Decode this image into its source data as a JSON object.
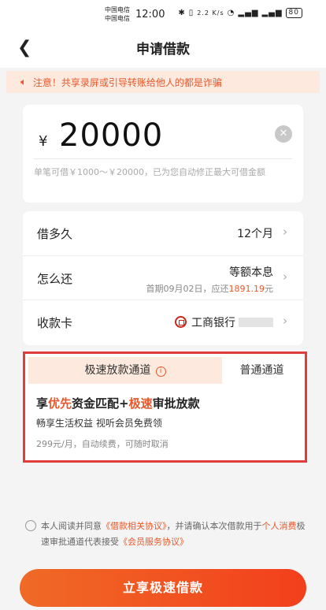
{
  "status_bar": {
    "carrier_1": "中国电信",
    "carrier_2": "中国电信",
    "time": "12:00",
    "network_speed": "2.2 K/s",
    "battery": "80"
  },
  "header": {
    "title": "申请借款"
  },
  "notice": {
    "text": "注意！共享录屏或引导转账给他人的都是诈骗"
  },
  "amount": {
    "currency": "¥",
    "value": "20000",
    "hint": "单笔可借￥1000～￥20000，已为您自动修正最大可借金额"
  },
  "rows": {
    "term": {
      "label": "借多久",
      "value": "12个月"
    },
    "repay": {
      "label": "怎么还",
      "value": "等额本息",
      "sub_prefix": "首期09月02日，应还",
      "sub_amount": "1891.19",
      "sub_suffix": "元"
    },
    "card": {
      "label": "收款卡",
      "value": "工商银行"
    }
  },
  "channels": {
    "fast_tab": "极速放款通道",
    "normal_tab": "普通通道",
    "title_parts": [
      "享",
      "优先",
      "资金匹配+",
      "极速",
      "审批放款"
    ],
    "subtitle": "畅享生活权益 视听会员免费领",
    "price": "299元/月，自动续费，可随时取消"
  },
  "agreement": {
    "part1": "本人阅读并同意",
    "link1": "《借款相关协议》",
    "part2": "，并请确认本次借款用于",
    "link2": "个人消费",
    "part3": "极速审批通道代表接受",
    "link3": "《会员服务协议》"
  },
  "cta": {
    "label": "立享极速借款"
  },
  "colors": {
    "accent": "#e8582a",
    "highlight_border": "#e03c3c"
  }
}
